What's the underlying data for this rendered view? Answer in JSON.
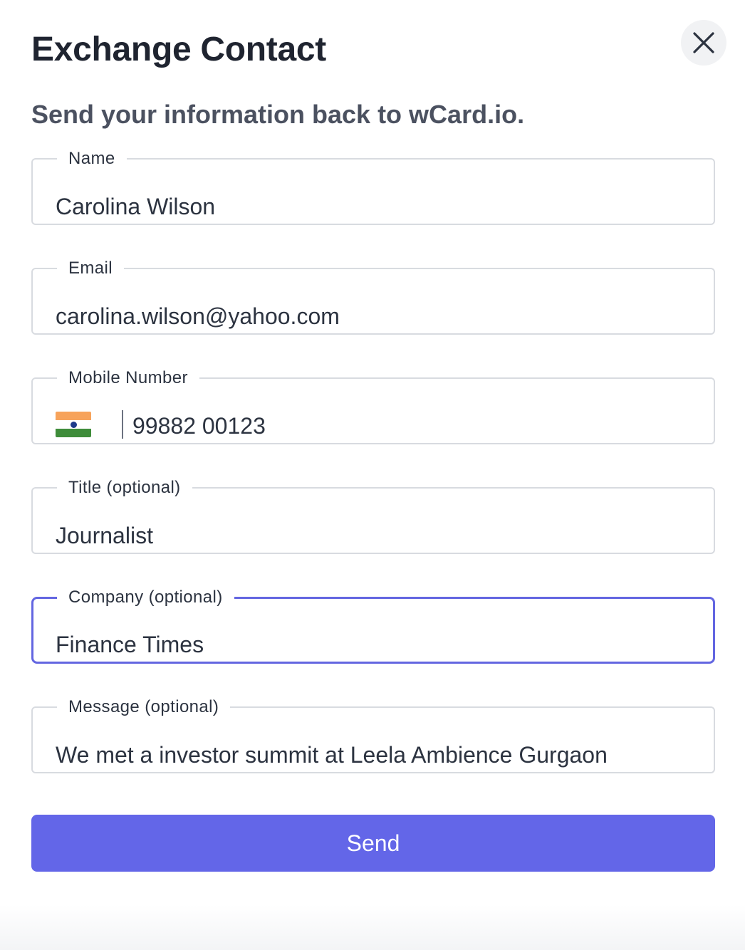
{
  "dialog": {
    "title": "Exchange Contact",
    "subtitle": "Send your information back to wCard.io.",
    "close_icon": "close-icon"
  },
  "form": {
    "name": {
      "label": "Name",
      "value": "Carolina Wilson"
    },
    "email": {
      "label": "Email",
      "value": "carolina.wilson@yahoo.com"
    },
    "mobile": {
      "label": "Mobile Number",
      "country_flag_icon": "india-flag-icon",
      "value": "99882 00123"
    },
    "title": {
      "label": "Title (optional)",
      "value": "Journalist"
    },
    "company": {
      "label": "Company (optional)",
      "value": "Finance Times",
      "focused": true
    },
    "message": {
      "label": "Message (optional)",
      "value": "We met a investor summit at Leela Ambience Gurgaon"
    }
  },
  "actions": {
    "send_label": "Send"
  },
  "colors": {
    "accent": "#6366E8",
    "focus_border": "#6366E1",
    "field_border": "#D8DBE0",
    "title_text": "#1F2430",
    "subtitle_text": "#4B5160"
  }
}
